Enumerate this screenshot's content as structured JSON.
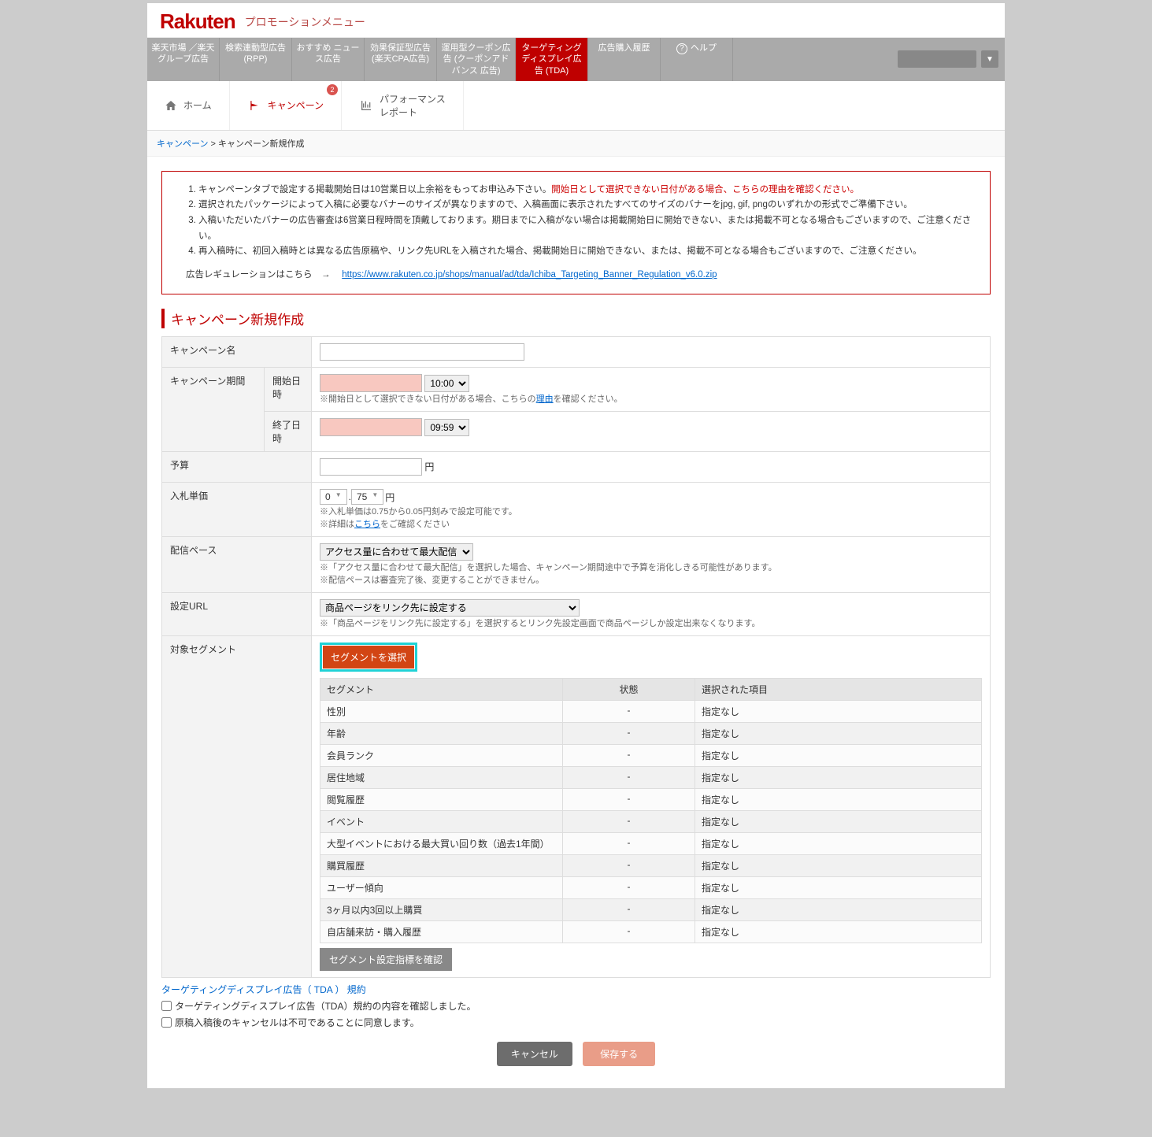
{
  "header": {
    "logo": "Rakuten",
    "logo_sub": "プロモーションメニュー"
  },
  "gnav": {
    "items": [
      "楽天市場\n／楽天グループ広告",
      "検索連動型広告\n(RPP)",
      "おすすめ\nニュース広告",
      "効果保証型広告\n(楽天CPA広告)",
      "運用型クーポン広告\n(クーポンアドバンス\n広告)",
      "ターゲティング\nディスプレイ広告\n(TDA)",
      "広告購入履歴"
    ],
    "help": "ヘルプ"
  },
  "subnav": {
    "home": "ホーム",
    "campaign": "キャンペーン",
    "badge": "2",
    "report_l1": "パフォーマンス",
    "report_l2": "レポート"
  },
  "breadcrumb": {
    "l1": "キャンペーン",
    "sep": " > ",
    "l2": "キャンペーン新規作成"
  },
  "notice": {
    "li1a": "キャンペーンタブで設定する掲載開始日は10営業日以上余裕をもってお申込み下さい。",
    "li1b": "開始日として選択できない日付がある場合、こちらの理由を確認ください。",
    "li2": "選択されたパッケージによって入稿に必要なバナーのサイズが異なりますので、入稿画面に表示されたすべてのサイズのバナーをjpg, gif, pngのいずれかの形式でご準備下さい。",
    "li3": "入稿いただいたバナーの広告審査は6営業日程時間を頂戴しております。期日までに入稿がない場合は掲載開始日に開始できない、または掲載不可となる場合もございますので、ご注意ください。",
    "li4": "再入稿時に、初回入稿時とは異なる広告原稿や、リンク先URLを入稿された場合、掲載開始日に開始できない、または、掲載不可となる場合もございますので、ご注意ください。",
    "reg_label": "広告レギュレーションはこちら　→　",
    "reg_url": "https://www.rakuten.co.jp/shops/manual/ad/tda/Ichiba_Targeting_Banner_Regulation_v6.0.zip"
  },
  "section_title": "キャンペーン新規作成",
  "form": {
    "name_label": "キャンペーン名",
    "period_label": "キャンペーン期間",
    "start_label": "開始日時",
    "end_label": "終了日時",
    "start_time": "10:00",
    "end_time": "09:59",
    "start_note_a": "※開始日として選択できない日付がある場合、こちらの",
    "start_note_link": "理由",
    "start_note_b": "を確認ください。",
    "budget_label": "予算",
    "budget_unit": "円",
    "bid_label": "入札単価",
    "bid_int": "0",
    "bid_dec": "75",
    "bid_dot": ". ",
    "bid_unit": "円",
    "bid_note1": "※入札単価は0.75から0.05円刻みで設定可能です。",
    "bid_note2a": "※詳細は",
    "bid_note2link": "こちら",
    "bid_note2b": "をご確認ください",
    "pace_label": "配信ペース",
    "pace_option": "アクセス量に合わせて最大配信",
    "pace_note1": "※「アクセス量に合わせて最大配信」を選択した場合、キャンペーン期間途中で予算を消化しきる可能性があります。",
    "pace_note2": "※配信ペースは審査完了後、変更することができません。",
    "url_label": "設定URL",
    "url_option": "商品ページをリンク先に設定する",
    "url_note": "※「商品ページをリンク先に設定する」を選択するとリンク先設定画面で商品ページしか設定出来なくなります。",
    "seg_label": "対象セグメント",
    "seg_select_btn": "セグメントを選択",
    "seg_check_btn": "セグメント設定指標を確認"
  },
  "seg_table": {
    "head": [
      "セグメント",
      "状態",
      "選択された項目"
    ],
    "rows": [
      {
        "name": "性別",
        "status": "-",
        "sel": "指定なし"
      },
      {
        "name": "年齢",
        "status": "-",
        "sel": "指定なし"
      },
      {
        "name": "会員ランク",
        "status": "-",
        "sel": "指定なし"
      },
      {
        "name": "居住地域",
        "status": "-",
        "sel": "指定なし"
      },
      {
        "name": "閲覧履歴",
        "status": "-",
        "sel": "指定なし"
      },
      {
        "name": "イベント",
        "status": "-",
        "sel": "指定なし"
      },
      {
        "name": "大型イベントにおける最大買い回り数（過去1年間）",
        "status": "-",
        "sel": "指定なし"
      },
      {
        "name": "購買履歴",
        "status": "-",
        "sel": "指定なし"
      },
      {
        "name": "ユーザー傾向",
        "status": "-",
        "sel": "指定なし"
      },
      {
        "name": "3ヶ月以内3回以上購買",
        "status": "-",
        "sel": "指定なし"
      },
      {
        "name": "自店舗来訪・購入履歴",
        "status": "-",
        "sel": "指定なし"
      }
    ]
  },
  "footer": {
    "terms_link": "ターゲティングディスプレイ広告（ TDA ） 規約",
    "chk1": "ターゲティングディスプレイ広告（TDA）規約の内容を確認しました。",
    "chk2": "原稿入稿後のキャンセルは不可であることに同意します。",
    "cancel": "キャンセル",
    "save": "保存する"
  }
}
